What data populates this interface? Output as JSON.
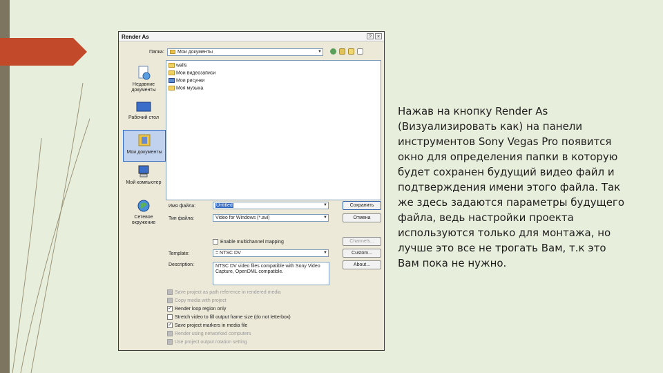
{
  "dialog": {
    "title": "Render As",
    "folder_label": "Папка:",
    "folder_value": "Мои документы",
    "places": [
      {
        "label": "Недавние документы",
        "icon": "recent-documents-icon"
      },
      {
        "label": "Рабочий стол",
        "icon": "desktop-icon"
      },
      {
        "label": "Мои документы",
        "icon": "my-documents-icon",
        "selected": true
      },
      {
        "label": "Мой компьютер",
        "icon": "my-computer-icon"
      },
      {
        "label": "Сетевое окружение",
        "icon": "network-icon"
      }
    ],
    "files": [
      {
        "name": "walls",
        "icon": "folder-icon"
      },
      {
        "name": "Мои видеозаписи",
        "icon": "video-folder-icon"
      },
      {
        "name": "Мои рисунки",
        "icon": "pictures-folder-icon"
      },
      {
        "name": "Моя музыка",
        "icon": "music-folder-icon"
      }
    ],
    "filename_label": "Имя файла:",
    "filename_value": "Untitled",
    "filetype_label": "Тип файла:",
    "filetype_value": "Video for Windows (*.avi)",
    "save_button": "Сохранить",
    "cancel_button": "Отмена",
    "channels_button": "Channels...",
    "custom_button": "Custom...",
    "about_button": "About...",
    "multichannel_label": "Enable multichannel mapping",
    "template_label": "Template:",
    "template_value": "= NTSC DV",
    "description_label": "Description:",
    "description_text": "NTSC DV video files compatible with Sony Video Capture, OpenDML compatible.",
    "options": [
      {
        "label": "Save project as path reference in rendered media",
        "checked": false,
        "disabled": true
      },
      {
        "label": "Copy media with project",
        "checked": false,
        "disabled": true
      },
      {
        "label": "Render loop region only",
        "checked": true,
        "disabled": false
      },
      {
        "label": "Stretch video to fill output frame size (do not letterbox)",
        "checked": false,
        "disabled": false
      },
      {
        "label": "Save project markers in media file",
        "checked": true,
        "disabled": false
      },
      {
        "label": "Render using networked computers",
        "checked": false,
        "disabled": true
      },
      {
        "label": "Use project output rotation setting",
        "checked": false,
        "disabled": true
      }
    ],
    "help_glyph": "?",
    "close_glyph": "×"
  },
  "caption": "Нажав на кнопку Render As (Визуализировать как) на панели инструментов Sony Vegas Pro появится окно для определения папки в которую будет сохранен будущий видео файл и подтверждения имени этого файла. Так же здесь задаются параметры будущего файла, ведь настройки проекта используются только для монтажа, но лучше это все не трогать Вам, т.к это Вам пока не нужно.",
  "colors": {
    "background": "#e8eedc",
    "stripe": "#7d7560",
    "ribbon": "#c24a2a",
    "accent": "#316ac5"
  }
}
